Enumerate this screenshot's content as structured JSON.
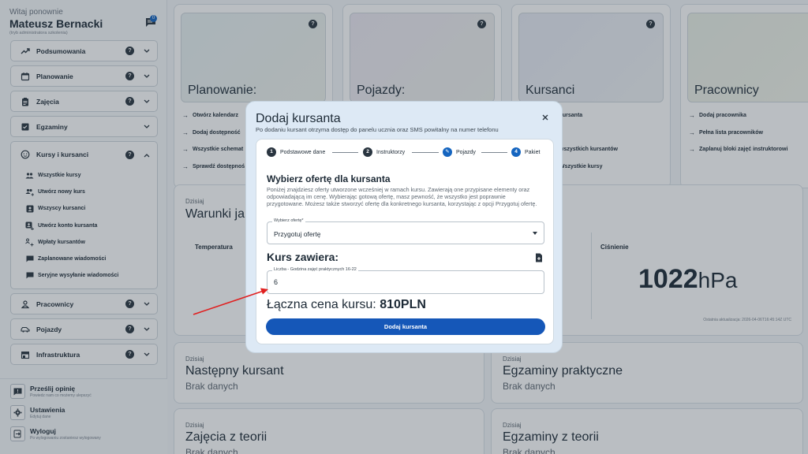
{
  "sidebar": {
    "welcome": "Witaj ponownie",
    "user_name": "Mateusz Bernacki",
    "user_role": "(tryb administratora szkolenia)",
    "message_count": "0",
    "nav": [
      {
        "label": "Podsumowania",
        "icon": "trend-icon",
        "help": "?"
      },
      {
        "label": "Planowanie",
        "icon": "calendar-icon",
        "help": "?"
      },
      {
        "label": "Zajęcia",
        "icon": "clipboard-icon",
        "help": "?"
      },
      {
        "label": "Egzaminy",
        "icon": "checklist-icon",
        "help": ""
      }
    ],
    "expanded": {
      "label": "Kursy i kursanci",
      "icon": "face-icon",
      "help": "?",
      "items": [
        {
          "label": "Wszystkie kursy",
          "icon": "group-icon"
        },
        {
          "label": "Utwórz nowy kurs",
          "icon": "group-add-icon"
        },
        {
          "label": "Wszyscy kursanci",
          "icon": "badge-icon"
        },
        {
          "label": "Utwórz konto kursanta",
          "icon": "person-add-icon"
        },
        {
          "label": "Wpłaty kursantów",
          "icon": "payment-icon"
        },
        {
          "label": "Zaplanowane wiadomości",
          "icon": "chat-icon"
        },
        {
          "label": "Seryjne wysyłanie wiadomości",
          "icon": "chat-multi-icon"
        }
      ]
    },
    "nav_after": [
      {
        "label": "Pracownicy",
        "icon": "person-icon",
        "help": "?"
      },
      {
        "label": "Pojazdy",
        "icon": "car-icon",
        "help": "?"
      },
      {
        "label": "Infrastruktura",
        "icon": "building-icon",
        "help": "?"
      }
    ],
    "bottom": [
      {
        "title": "Prześlij opinię",
        "sub": "Powiedz nam co możemy ulepszyć",
        "icon": "feedback-icon"
      },
      {
        "title": "Ustawienia",
        "sub": "Edytuj dane",
        "icon": "gear-icon"
      },
      {
        "title": "Wyloguj",
        "sub": "Po wylogowaniu zostaniesz wylogowany",
        "icon": "logout-icon"
      }
    ]
  },
  "dashboard": {
    "cards": [
      {
        "title": "Planowanie:",
        "links": [
          "Otwórz kalendarz",
          "Dodaj dostępność",
          "Wszystkie schemat",
          "Sprawdź dostępnoś"
        ]
      },
      {
        "title": "Pojazdy:",
        "links": []
      },
      {
        "title": "Kursanci",
        "links": [
          "kursanta",
          "s",
          "wszystkich kursantów",
          "Wszystkie kursy"
        ]
      },
      {
        "title": "Pracownicy",
        "links": [
          "Dodaj pracownika",
          "Pełna lista pracowników",
          "Zaplanuj bloki zajęć instruktorowi"
        ]
      }
    ],
    "weather": {
      "small": "Dzisiaj",
      "title": "Warunki ja",
      "temperature_label": "Temperatura",
      "pressure_label": "Ciśnienie",
      "pressure_value": "1022",
      "pressure_unit": "hPa",
      "updated": "Ostatnia aktualizacja: 2026-04-06T16:45:14Z UTC"
    },
    "bottom_cards": [
      {
        "small": "Dzisiaj",
        "title": "Następny kursant",
        "nodata": "Brak danych"
      },
      {
        "small": "Dzisiaj",
        "title": "Egzaminy praktyczne",
        "nodata": "Brak danych"
      },
      {
        "small": "Dzisiaj",
        "title": "Zajęcia z teorii",
        "nodata": "Brak danych"
      },
      {
        "small": "Dzisiaj",
        "title": "Egzaminy z teorii",
        "nodata": "Brak danych"
      }
    ]
  },
  "modal": {
    "title": "Dodaj kursanta",
    "subtitle": "Po dodaniu kursant otrzyma dostęp do panelu ucznia oraz SMS powitalny na numer telefonu",
    "steps": [
      {
        "num": "1",
        "label": "Podstawowe dane"
      },
      {
        "num": "2",
        "label": "Instruktorzy"
      },
      {
        "num": "✎",
        "label": "Pojazdy"
      },
      {
        "num": "4",
        "label": "Pakiet"
      }
    ],
    "offer_title": "Wybierz ofertę dla kursanta",
    "offer_desc": "Poniżej znajdziesz oferty utworzone wcześniej w ramach kursu. Zawierają one przypisane elementy oraz odpowiadającą im cenę. Wybierając gotową ofertę, masz pewność, że wszystko jest poprawnie przygotowane. Możesz także stworzyć ofertę dla konkretnego kursanta, korzystając z opcji Przygotuj ofertę.",
    "select_label": "Wybierz ofertę*",
    "select_value": "Przygotuj ofertę",
    "course_title": "Kurs zawiera:",
    "hours_label": "Liczba - Godzina zajęć praktycznych 16-22",
    "hours_value": "6",
    "price_label": "Łączna cena kursu: ",
    "price_value": "810PLN",
    "submit_label": "Dodaj kursanta"
  },
  "colors": {
    "primary": "#1557b8",
    "badge": "#1565c0",
    "annotation": "#e02020"
  }
}
